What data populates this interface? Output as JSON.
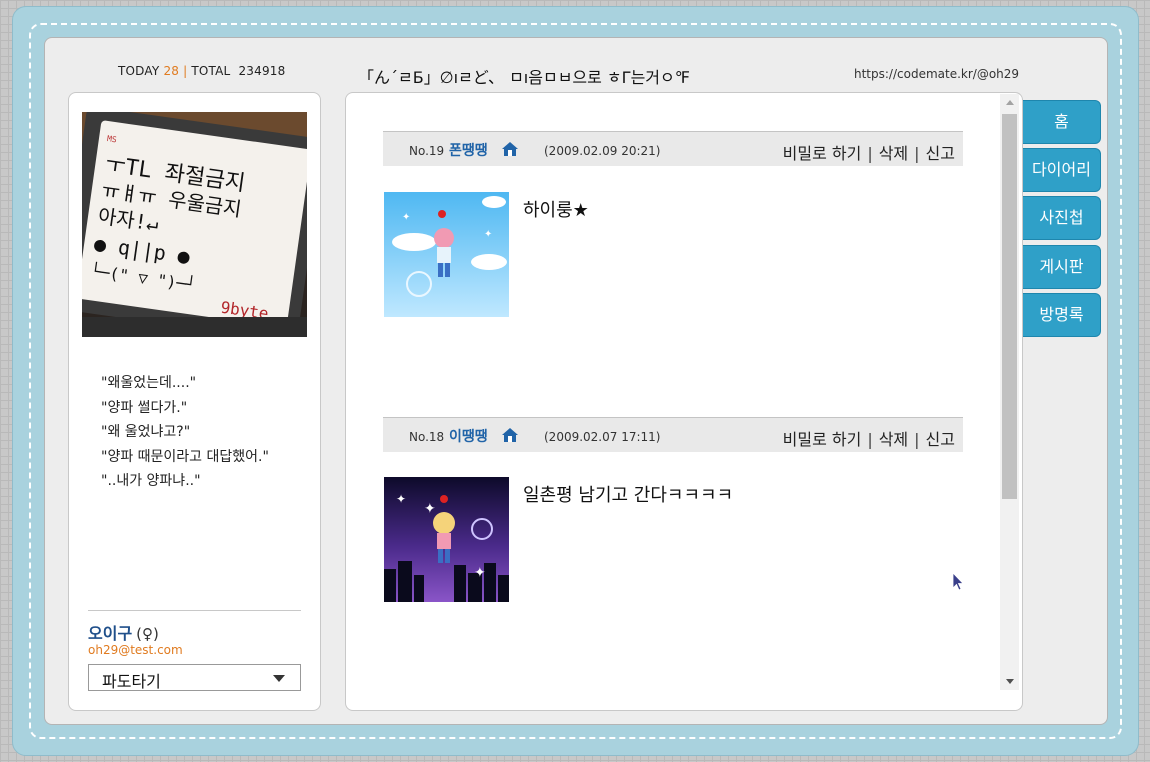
{
  "header": {
    "today_label": "TODAY",
    "today_count": "28",
    "total_label": "TOTAL",
    "total_count": "234918",
    "title": "「ん΄ㄹБ」∅ıㄹど、 ㅁı음ㅁㅂ으로 ㅎΓ는거ㅇ℉",
    "url": "https://codemate.kr/@oh29"
  },
  "profile": {
    "image": {
      "semantic": "phone-screen-photo",
      "lines": [
        "ㅜTL 좌절금지",
        "ㅠㅒㅠ 우울금지",
        "아자!↵",
        "● q||p ●",
        "└─(\" ▽ \")─┘"
      ],
      "brand": "9byte"
    },
    "bio_lines": [
      "\"왜울었는데....\"",
      "\"양파 썰다가.\"",
      "\"왜 울었냐고?\"",
      "\"양파 때문이라고 대답했어.\"",
      "\"..내가 양파냐..\""
    ],
    "name": "오이구",
    "gender": "(♀)",
    "email": "oh29@test.com",
    "wave_select": "파도타기"
  },
  "guestbook": {
    "entries": [
      {
        "no": "No.19",
        "name": "폰땡땡",
        "home_icon": "home-icon",
        "date": "(2009.02.09 20:21)",
        "actions": [
          "비밀로 하기",
          "삭제",
          "신고"
        ],
        "avatar": "minimi-day-clouds",
        "message": "하이룽★"
      },
      {
        "no": "No.18",
        "name": "이땡땡",
        "home_icon": "home-icon",
        "date": "(2009.02.07 17:11)",
        "actions": [
          "비밀로 하기",
          "삭제",
          "신고"
        ],
        "avatar": "minimi-night-city",
        "message": "일촌평 남기고 간다ㅋㅋㅋㅋ"
      }
    ]
  },
  "tabs": [
    "홈",
    "다이어리",
    "사진첩",
    "게시판",
    "방명록"
  ],
  "colors": {
    "frame": "#a9d2de",
    "tab": "#2fa0c8",
    "accent_orange": "#e07b20",
    "name_blue": "#2164a8"
  }
}
